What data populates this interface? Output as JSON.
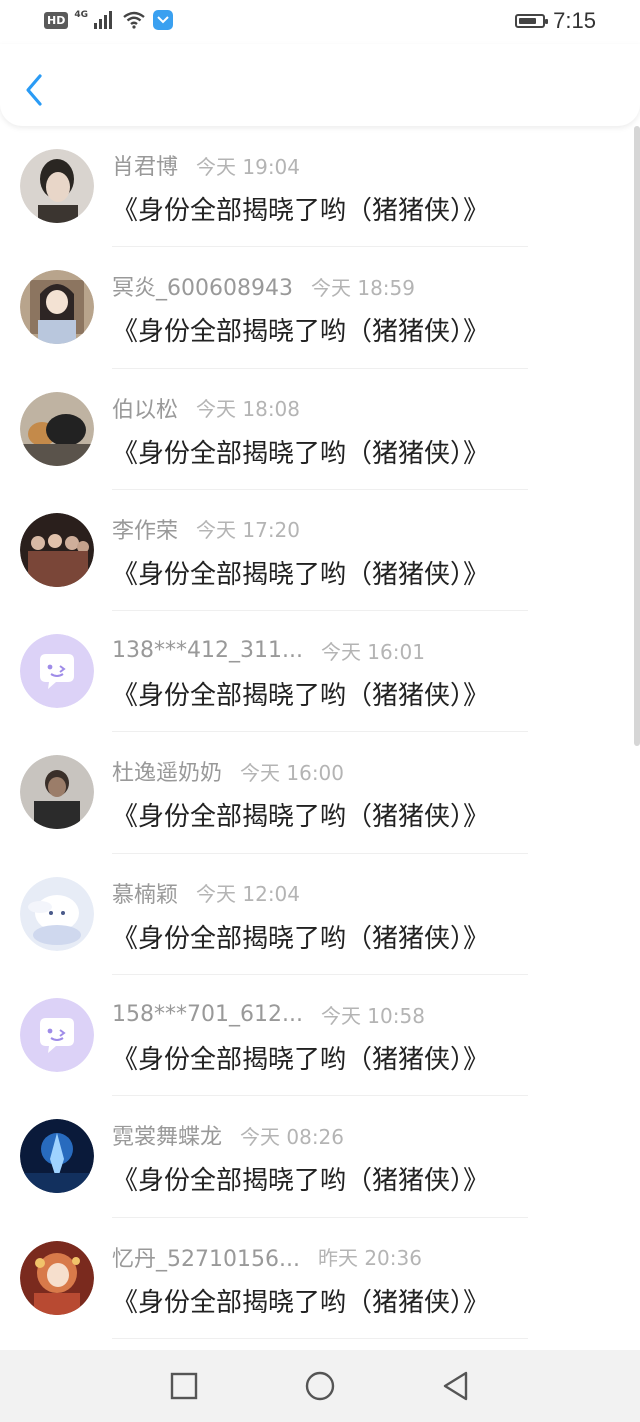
{
  "status_bar": {
    "hd_label": "HD",
    "network_label": "4G",
    "time": "7:15",
    "battery_level": 0.75
  },
  "header": {
    "back_icon": "chevron-left-icon",
    "accent_color": "#2a9bf5"
  },
  "messages": [
    {
      "name": "肖君博",
      "time": "今天 19:04",
      "text": "《身份全部揭晓了哟（猪猪侠）》",
      "avatar": "photo-person"
    },
    {
      "name": "冥炎_600608943",
      "time": "今天 18:59",
      "text": "《身份全部揭晓了哟（猪猪侠）》",
      "avatar": "photo-anime-girl"
    },
    {
      "name": "伯以松",
      "time": "今天 18:08",
      "text": "《身份全部揭晓了哟（猪猪侠）》",
      "avatar": "photo-dog"
    },
    {
      "name": "李作荣",
      "time": "今天 17:20",
      "text": "《身份全部揭晓了哟（猪猪侠）》",
      "avatar": "photo-group"
    },
    {
      "name": "138***412_311...",
      "time": "今天 16:01",
      "text": "《身份全部揭晓了哟（猪猪侠）》",
      "avatar": "default-chat-icon"
    },
    {
      "name": "杜逸遥奶奶",
      "time": "今天 16:00",
      "text": "《身份全部揭晓了哟（猪猪侠）》",
      "avatar": "photo-elder"
    },
    {
      "name": "慕楠颖",
      "time": "今天 12:04",
      "text": "《身份全部揭晓了哟（猪猪侠）》",
      "avatar": "photo-cinnamoroll"
    },
    {
      "name": "158***701_612...",
      "time": "今天 10:58",
      "text": "《身份全部揭晓了哟（猪猪侠）》",
      "avatar": "default-chat-icon"
    },
    {
      "name": "霓裳舞蝶龙",
      "time": "今天 08:26",
      "text": "《身份全部揭晓了哟（猪猪侠）》",
      "avatar": "photo-blue-warrior"
    },
    {
      "name": "忆丹_52710156...",
      "time": "昨天 20:36",
      "text": "《身份全部揭晓了哟（猪猪侠）》",
      "avatar": "photo-anime-red"
    }
  ],
  "nav_bar": {
    "recent_icon": "square-icon",
    "home_icon": "circle-icon",
    "back_icon": "triangle-back-icon"
  }
}
